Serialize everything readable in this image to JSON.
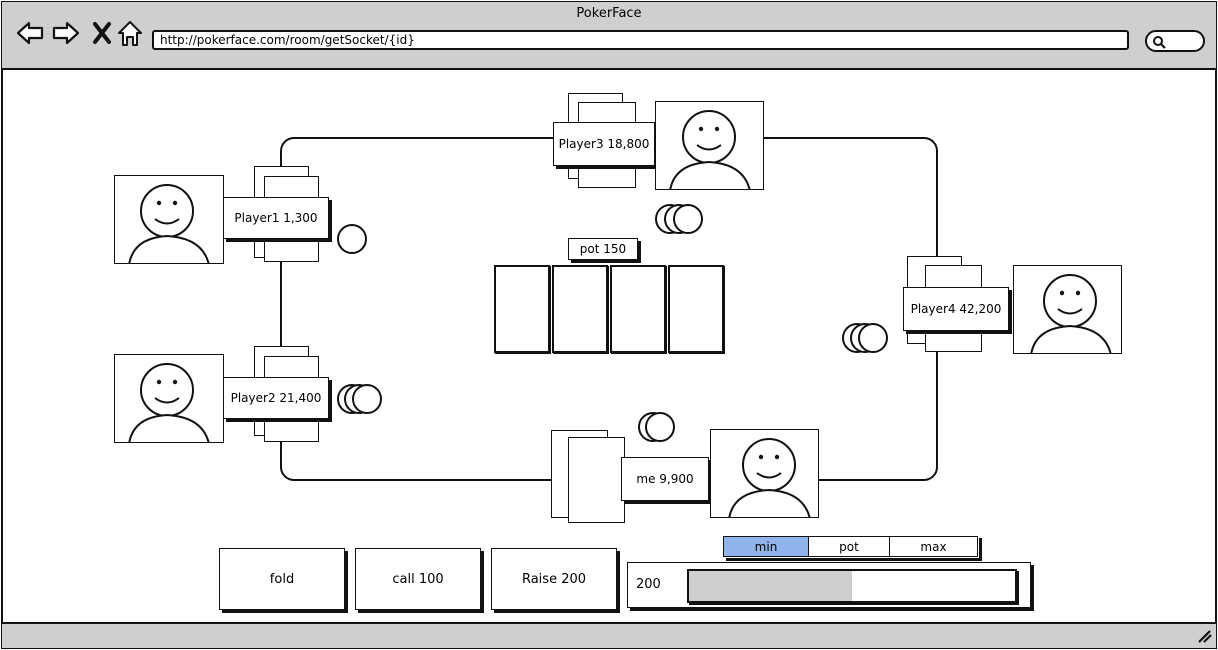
{
  "browser": {
    "title": "PokerFace",
    "url": "http://pokerface.com/room/getSocket/{id}"
  },
  "table": {
    "pot_label": "pot 150"
  },
  "players": {
    "p1": {
      "label": "Player1 1,300"
    },
    "p2": {
      "label": "Player2 21,400"
    },
    "p3": {
      "label": "Player3 18,800"
    },
    "p4": {
      "label": "Player4 42,200"
    },
    "me": {
      "label": "me 9,900"
    }
  },
  "actions": {
    "fold": "fold",
    "call": "call 100",
    "raise": "Raise 200"
  },
  "raise_control": {
    "value": "200",
    "presets": [
      "min",
      "pot",
      "max"
    ],
    "selected": "min",
    "slider_fraction": 0.5
  },
  "colors": {
    "chrome": "#cfcfcf",
    "selected": "#8fb3ea"
  },
  "icons": [
    "back-icon",
    "forward-icon",
    "close-icon",
    "home-icon",
    "search-icon",
    "resize-grip-icon"
  ]
}
